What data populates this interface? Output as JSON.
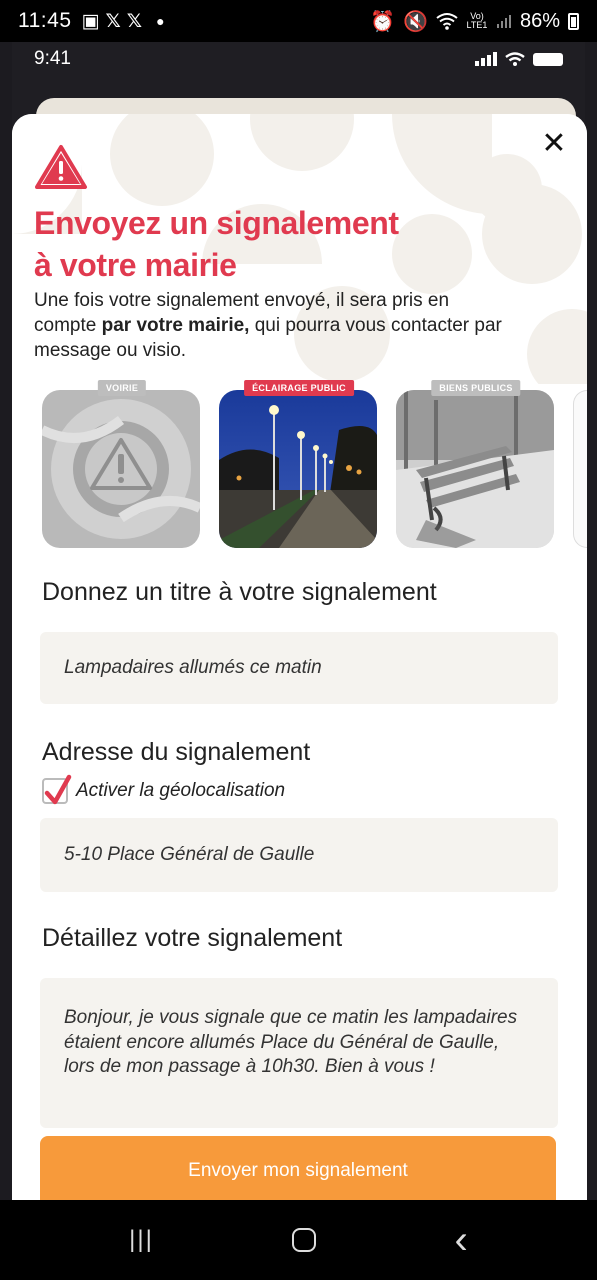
{
  "system_status": {
    "time": "11:45",
    "battery": "86%",
    "icons": [
      "image-icon",
      "x-icon",
      "x-icon",
      "dot-icon",
      "alarm-icon",
      "mute-icon",
      "wifi-icon",
      "volte-icon",
      "signal-icon",
      "battery-icon"
    ],
    "volte_label": "Vo) LTE1"
  },
  "app_status": {
    "time": "9:41"
  },
  "sheet": {
    "title_line1": "Envoyez un signalement",
    "title_line2": "à votre mairie",
    "intro_part1": "Une fois votre signalement envoyé, il sera pris en compte ",
    "intro_bold": "par votre mairie,",
    "intro_part2": " qui pourra vous contacter par message ou visio.",
    "accent_color": "#e03a4f"
  },
  "categories": [
    {
      "label": "VOIRIE",
      "selected": false
    },
    {
      "label": "ÉCLAIRAGE PUBLIC",
      "selected": true
    },
    {
      "label": "BIENS PUBLICS",
      "selected": false
    }
  ],
  "form": {
    "title_label": "Donnez un titre à votre signalement",
    "title_value": "Lampadaires allumés ce matin",
    "address_label": "Adresse du signalement",
    "geoloc_label": "Activer la géolocalisation",
    "geoloc_checked": true,
    "address_value": "5-10 Place Général de Gaulle",
    "details_label": "Détaillez votre signalement",
    "details_value": "Bonjour, je vous signale que ce matin les lampadaires étaient encore allumés Place du Général de Gaulle, lors de mon passage à 10h30. Bien à vous !",
    "submit_label": "Envoyer mon signalement",
    "submit_color": "#f79a3b"
  },
  "nav": {
    "recents": "|||",
    "back": "‹"
  }
}
